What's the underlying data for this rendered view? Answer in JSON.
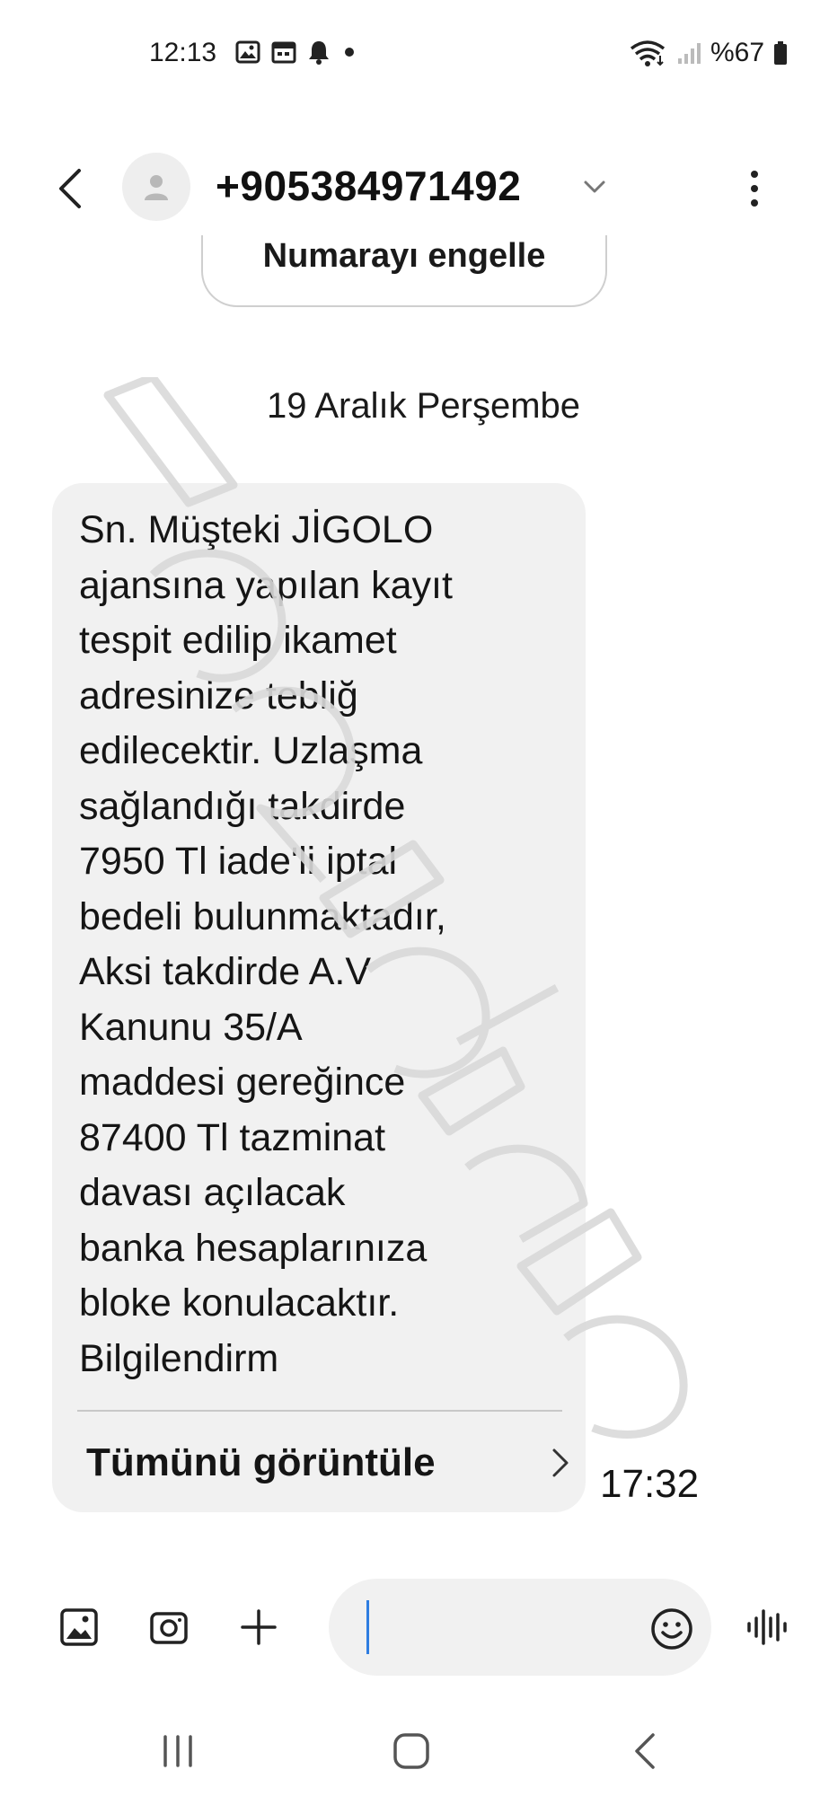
{
  "status_bar": {
    "time": "12:13",
    "battery": "%67",
    "left_icons": [
      "image-notification-icon",
      "calendar-notification-icon",
      "bell-notification-icon",
      "more-notifications-dot-icon"
    ],
    "right_icons": [
      "wifi-icon",
      "cellular-signal-icon",
      "battery-icon"
    ]
  },
  "header": {
    "contact_name": "+905384971492"
  },
  "actions": {
    "block_number": "Numarayı engelle"
  },
  "conversation": {
    "date": "19 Aralık Perşembe",
    "message": {
      "lines": [
        "Sn. Müşteki JİGOLO",
        "ajansına yapılan kayıt",
        "tespit edilip ikamet",
        "adresinize tebliğ",
        "edilecektir. Uzlaşma",
        "sağlandığı takdirde",
        "7950 Tl iade'li iptal",
        "bedeli bulunmaktadır,",
        "Aksi takdirde A.V",
        "Kanunu 35/A",
        "maddesi gereğince",
        "87400 Tl tazminat",
        "davası açılacak",
        "banka hesaplarınıza",
        "bloke konulacaktır.",
        "Bilgilendirm"
      ],
      "view_all": "Tümünü görüntüle",
      "time": "17:32"
    }
  },
  "composer": {
    "text": ""
  }
}
